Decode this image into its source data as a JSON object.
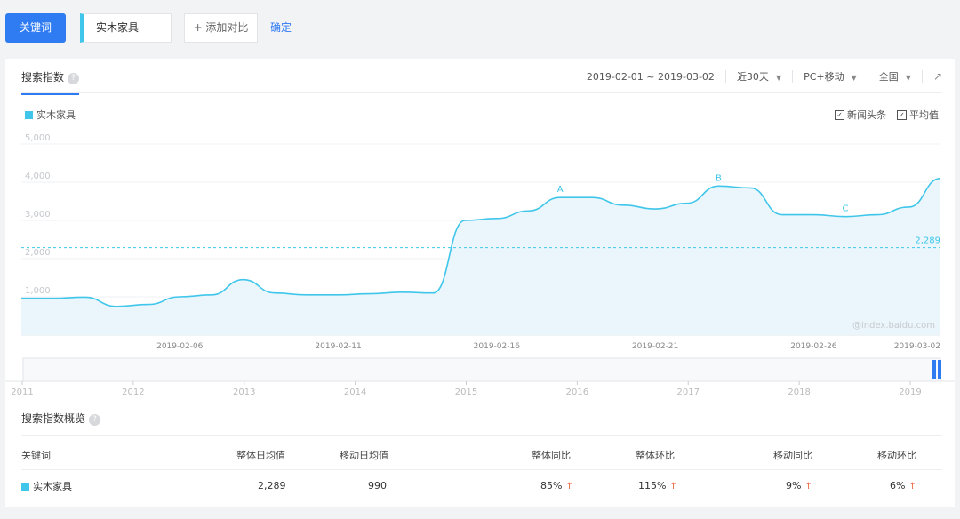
{
  "topbar": {
    "keyword_button": "关键词",
    "keyword_value": "实木家具",
    "add_compare": "+ 添加对比",
    "confirm": "确定"
  },
  "panel": {
    "tab_label": "搜索指数",
    "help_icon": "?",
    "date_range": "2019-02-01 ~ 2019-03-02",
    "period": "近30天",
    "device": "PC+移动",
    "region": "全国",
    "export_icon": "↗"
  },
  "legend": {
    "series_name": "实木家具",
    "color": "#3fc6ea"
  },
  "checks": {
    "news": "新闻头条",
    "average": "平均值"
  },
  "chart_data": {
    "type": "area",
    "series": [
      {
        "name": "实木家具",
        "x": [
          "2019-02-01",
          "2019-02-02",
          "2019-02-03",
          "2019-02-04",
          "2019-02-05",
          "2019-02-06",
          "2019-02-07",
          "2019-02-08",
          "2019-02-09",
          "2019-02-10",
          "2019-02-11",
          "2019-02-12",
          "2019-02-13",
          "2019-02-14",
          "2019-02-15",
          "2019-02-16",
          "2019-02-17",
          "2019-02-18",
          "2019-02-19",
          "2019-02-20",
          "2019-02-21",
          "2019-02-22",
          "2019-02-23",
          "2019-02-24",
          "2019-02-25",
          "2019-02-26",
          "2019-02-27",
          "2019-02-28",
          "2019-03-01",
          "2019-03-02"
        ],
        "values": [
          960,
          960,
          990,
          750,
          800,
          1000,
          1050,
          1450,
          1100,
          1050,
          1050,
          1080,
          1120,
          1100,
          3000,
          3050,
          3250,
          3600,
          3600,
          3400,
          3300,
          3450,
          3900,
          3850,
          3150,
          3150,
          3100,
          3150,
          3350,
          4100
        ]
      }
    ],
    "x_ticks": [
      "2019-02-06",
      "2019-02-11",
      "2019-02-16",
      "2019-02-21",
      "2019-02-26",
      "2019-03-02"
    ],
    "y_ticks": [
      "5,000",
      "4,000",
      "3,000",
      "2,000",
      "1,000"
    ],
    "ylim": [
      0,
      5000
    ],
    "average": 2289,
    "average_label": "2,289",
    "markers": [
      {
        "label": "A",
        "x": "2019-02-18"
      },
      {
        "label": "B",
        "x": "2019-02-23"
      },
      {
        "label": "C",
        "x": "2019-02-27"
      }
    ],
    "watermark": "@index.baidu.com",
    "timeline_years": [
      "2011",
      "2012",
      "2013",
      "2014",
      "2015",
      "2016",
      "2017",
      "2018",
      "2019"
    ],
    "grid": true,
    "legend_position": "top-left"
  },
  "summary": {
    "title": "搜索指数概览",
    "headers": [
      "关键词",
      "整体日均值",
      "移动日均值",
      "整体同比",
      "整体环比",
      "移动同比",
      "移动环比"
    ],
    "row": {
      "keyword": "实木家具",
      "overall_avg": "2,289",
      "mobile_avg": "990",
      "overall_yoy": "85%",
      "overall_mom": "115%",
      "mobile_yoy": "9%",
      "mobile_mom": "6%"
    },
    "trend_icon": "↑"
  }
}
